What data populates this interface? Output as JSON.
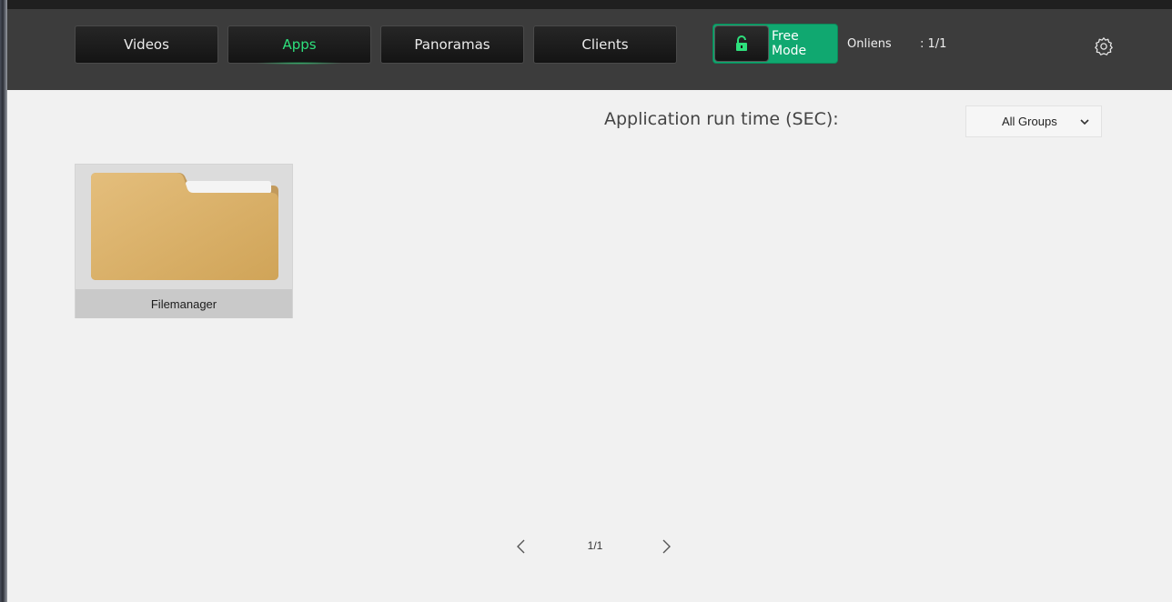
{
  "nav": {
    "tabs": [
      {
        "label": "Videos",
        "active": false
      },
      {
        "label": "Apps",
        "active": true
      },
      {
        "label": "Panoramas",
        "active": false
      },
      {
        "label": "Clients",
        "active": false
      }
    ],
    "accent_color": "#2ee07c"
  },
  "mode": {
    "label": "Free Mode",
    "icon": "unlock-icon",
    "color": "#10a870"
  },
  "status": {
    "online_label": "Onliens",
    "online_count": ": 1/1"
  },
  "settings": {
    "icon": "gear-icon"
  },
  "content": {
    "run_time_label": "Application run time (SEC):",
    "group_filter": {
      "selected": "All Groups"
    },
    "apps": [
      {
        "name": "Filemanager",
        "icon": "folder-icon"
      }
    ]
  },
  "pagination": {
    "page_text": "1/1"
  }
}
